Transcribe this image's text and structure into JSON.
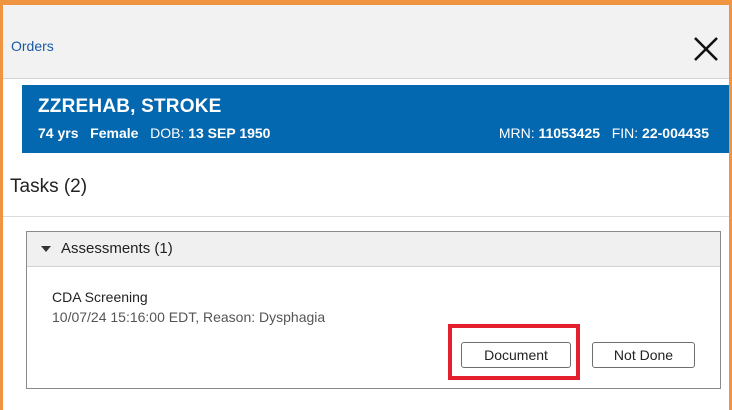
{
  "window": {
    "title": "Orders",
    "close_icon": "close-icon",
    "frame_color": "#ef9440"
  },
  "patient": {
    "name": "ZZREHAB, STROKE",
    "age": "74 yrs",
    "sex": "Female",
    "dob_label": "DOB:",
    "dob": "13 SEP 1950",
    "mrn_label": "MRN:",
    "mrn": "11053425",
    "fin_label": "FIN:",
    "fin": "22-004435",
    "banner_color": "#0468b0"
  },
  "tasks": {
    "title": "Tasks (2)",
    "groups": [
      {
        "label": "Assessments (1)",
        "expanded": true,
        "items": [
          {
            "name": "CDA Screening",
            "detail": "10/07/24 15:16:00 EDT, Reason: Dysphagia",
            "actions": {
              "document_label": "Document",
              "not_done_label": "Not Done"
            }
          }
        ]
      }
    ]
  },
  "annotation": {
    "highlight_color": "#e5202e",
    "highlight_target": "Document"
  }
}
